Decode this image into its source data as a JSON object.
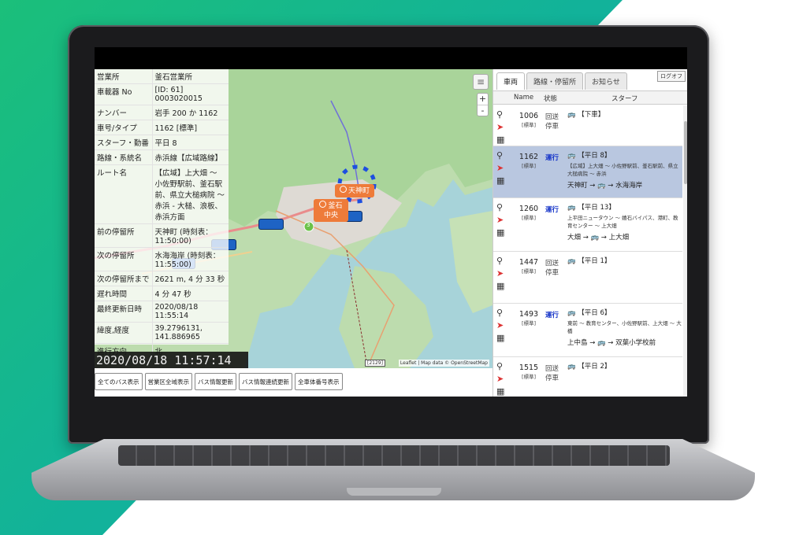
{
  "info_table": [
    {
      "key": "営業所",
      "value": "釜石営業所"
    },
    {
      "key": "車載器 No",
      "value": "[ID: 61] 0003020015"
    },
    {
      "key": "ナンバー",
      "value": "岩手 200 か 1162"
    },
    {
      "key": "車号/タイプ",
      "value": "1162 [標準]"
    },
    {
      "key": "スターフ・勤番",
      "value": "平日 8"
    },
    {
      "key": "路線・系統名",
      "value": "赤浜線【広域路線】"
    },
    {
      "key": "ルート名",
      "value": "【広域】上大畑 ～ 小佐野駅前、釜石駅前、県立大槌病院 ～ 赤浜 - 大槌、浪板、赤浜方面"
    },
    {
      "key": "前の停留所",
      "value": "天神町 (時刻表：11:50:00)"
    },
    {
      "key": "次の停留所",
      "value": "水海海岸 (時刻表：11:55:00)"
    },
    {
      "key": "次の停留所まで",
      "value": "2621 m, 4 分 33 秒"
    },
    {
      "key": "遅れ時間",
      "value": "4 分 47 秒"
    },
    {
      "key": "最終更新日時",
      "value": "2020/08/18 11:55:14"
    },
    {
      "key": "緯度,経度",
      "value": "39.2796131, 141.886965"
    },
    {
      "key": "進行方向",
      "value": "北"
    }
  ],
  "clock": "2020/08/18 11:57:14",
  "map_buttons": [
    "全てのバス表示",
    "営業区全域表示",
    "バス情報更新",
    "バス情報連続更新",
    "全車体番号表示"
  ],
  "map": {
    "zoom_in": "+",
    "zoom_out": "-",
    "attribution": "Leaflet | Map data © OpenStreetMap",
    "stop_labels": [
      "天神町",
      "釜石中央"
    ],
    "route_tag": "[2129]",
    "cluster_count": "3"
  },
  "panel": {
    "tabs": [
      "車両",
      "路線・停留所",
      "お知らせ"
    ],
    "logout": "ログオフ",
    "headers": {
      "name": "Name",
      "status": "状態",
      "staff": "スターフ"
    },
    "rows": [
      {
        "name": "1006",
        "type": "[標準]",
        "status": "回送\n停車",
        "run": false,
        "staff": "【下車】",
        "desc": "",
        "route": ""
      },
      {
        "name": "1162",
        "type": "[標準]",
        "status": "運行",
        "run": true,
        "selected": true,
        "staff": "【平日 8】",
        "desc": "【広域】上大畑 ～ 小佐野駅前、釜石駅前、県立大槌病院 ～ 赤浜",
        "route": "天神町 → 🚌 → 水海海岸"
      },
      {
        "name": "1260",
        "type": "[標準]",
        "status": "運行",
        "run": true,
        "staff": "【平日 13】",
        "desc": "上平田ニュータウン ～ 嬉石バイパス、港町、教育センター ～ 上大畑",
        "route": "大畑 → 🚌 → 上大畑"
      },
      {
        "name": "1447",
        "type": "[標準]",
        "status": "回送\n停車",
        "run": false,
        "staff": "【平日 1】",
        "desc": "",
        "route": ""
      },
      {
        "name": "1493",
        "type": "[標準]",
        "status": "運行",
        "run": true,
        "staff": "【平日 6】",
        "desc": "東前 ～ 教育センター、小佐野駅前、上大畑 ～ 大橋",
        "route": "上中島 → 🚌 → 双葉小学校前"
      },
      {
        "name": "1515",
        "type": "[標準]",
        "status": "回送\n停車",
        "run": false,
        "staff": "【平日 2】",
        "desc": "",
        "route": ""
      }
    ]
  },
  "colors": {
    "accent_green": "#1bbf7a",
    "orange": "#ee7b3a",
    "run_blue": "#1433c8",
    "selected_row": "#b9c7e0"
  }
}
